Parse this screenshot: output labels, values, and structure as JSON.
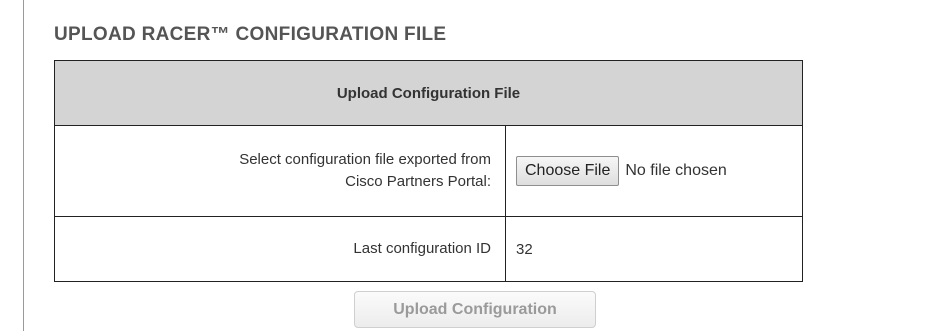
{
  "section": {
    "title": "UPLOAD RACER™ CONFIGURATION FILE"
  },
  "table": {
    "header": "Upload Configuration File",
    "file_row": {
      "label_line1": "Select configuration file exported from",
      "label_line2": "Cisco Partners Portal:",
      "choose_button_label": "Choose File",
      "file_status": "No file chosen"
    },
    "id_row": {
      "label": "Last configuration ID",
      "value": "32"
    }
  },
  "actions": {
    "upload_label": "Upload Configuration",
    "upload_disabled": true
  }
}
